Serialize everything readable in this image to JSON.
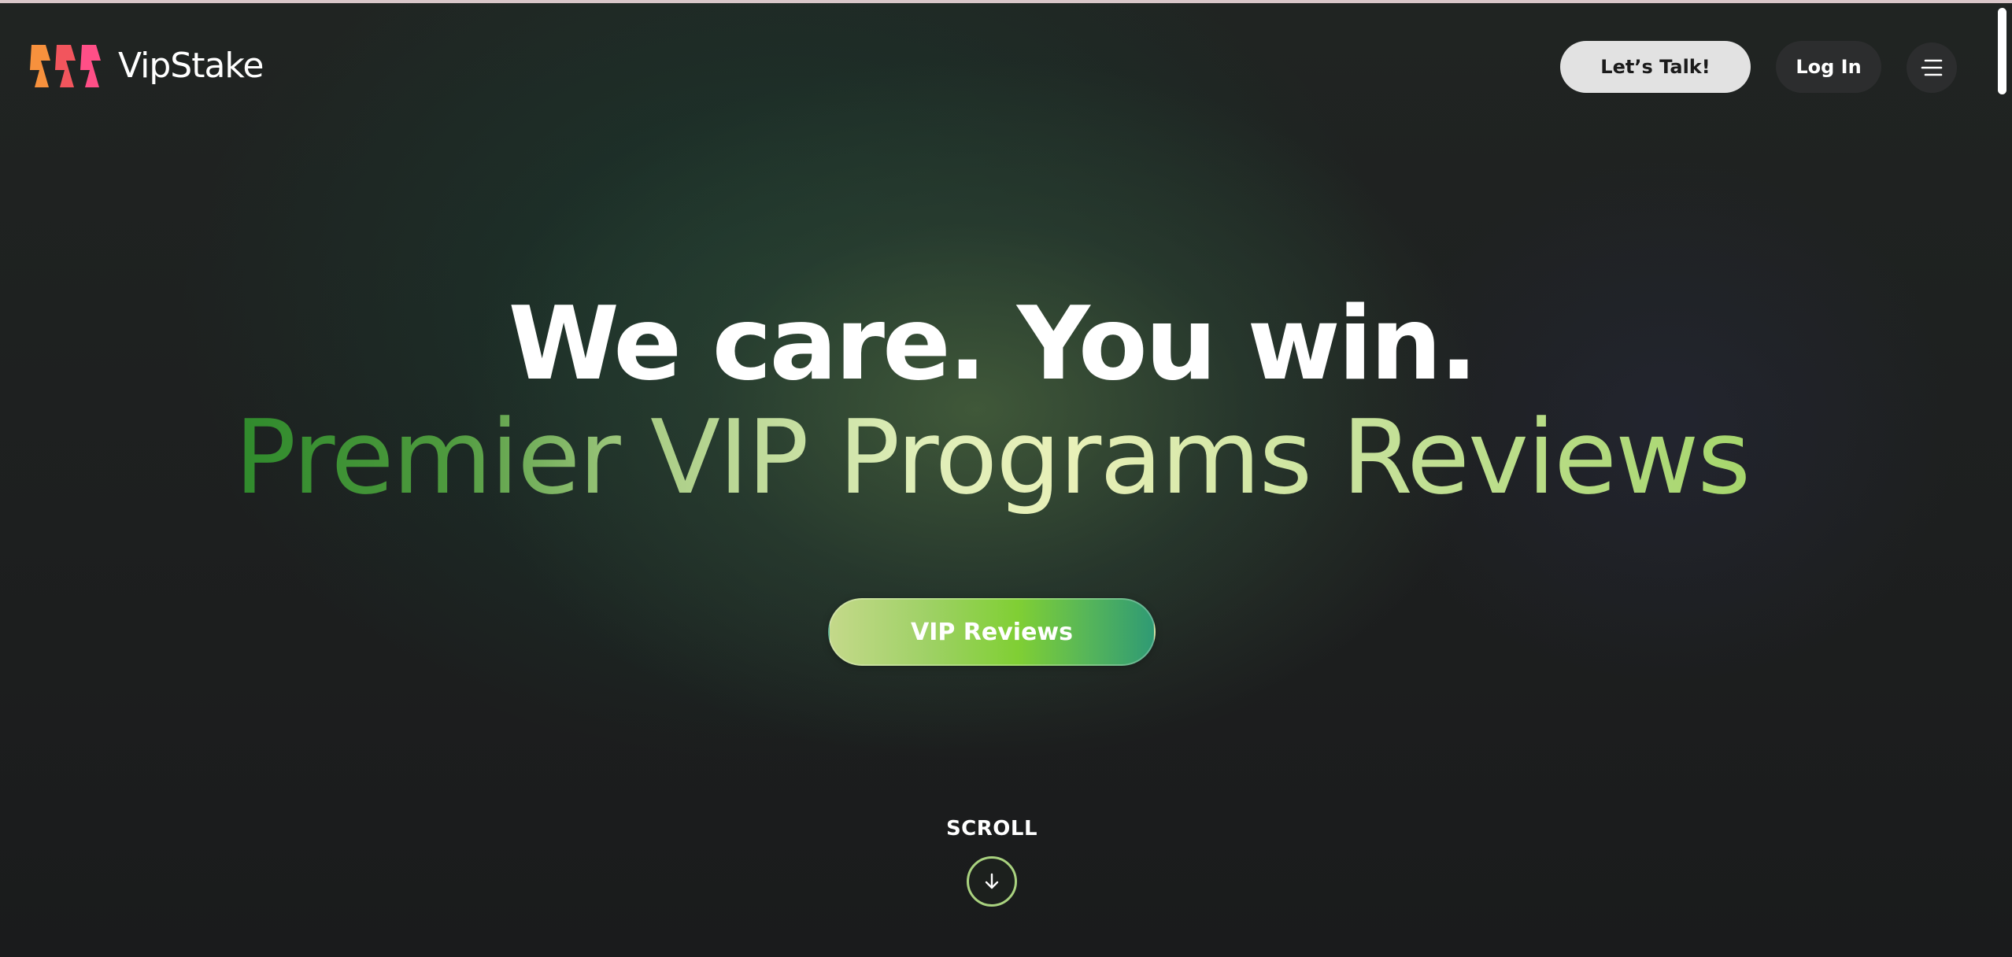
{
  "header": {
    "brand_name": "VipStake",
    "logo_icon": "three-slanted-bolts-logo",
    "lets_talk_label": "Let’s Talk!",
    "login_label": "Log In",
    "menu_icon": "hamburger-menu-icon"
  },
  "hero": {
    "headline_line1": "We care. You win.",
    "headline_line2": "Premier VIP Programs Reviews",
    "cta_label": "VIP Reviews"
  },
  "scroll": {
    "label": "SCROLL",
    "icon": "arrow-down-icon"
  },
  "colors": {
    "background": "#1c1d1f",
    "headline_gradient_start": "#2f8a2c",
    "headline_gradient_end": "#a6d66c",
    "cta_gradient_start": "#c4d98a",
    "cta_gradient_end": "#2f9a74",
    "logo_orange": "#f7913d",
    "logo_red": "#f2555d",
    "logo_pink": "#ff4f87"
  }
}
